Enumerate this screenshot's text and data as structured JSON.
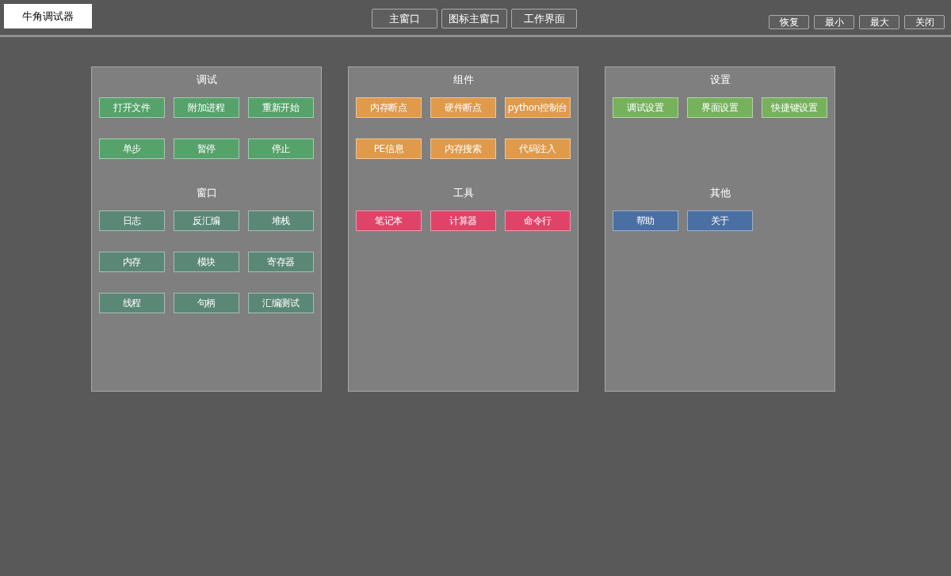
{
  "window": {
    "title": "牛角调试器"
  },
  "nav_buttons": [
    "主窗口",
    "图标主窗口",
    "工作界面"
  ],
  "window_controls": [
    "恢复",
    "最小",
    "最大",
    "关闭"
  ],
  "panels": [
    {
      "sections": [
        {
          "title": "调试",
          "color": "#55a36b",
          "buttons": [
            "打开文件",
            "附加进程",
            "重新开始",
            "单步",
            "暂停",
            "停止"
          ]
        },
        {
          "title": "窗口",
          "color": "#5b8777",
          "buttons": [
            "日志",
            "反汇编",
            "堆栈",
            "内存",
            "模块",
            "寄存器",
            "线程",
            "句柄",
            "汇编测试"
          ]
        }
      ]
    },
    {
      "sections": [
        {
          "title": "组件",
          "color": "#e09a4a",
          "buttons": [
            "内存断点",
            "硬件断点",
            "python控制台",
            "PE信息",
            "内存搜索",
            "代码注入"
          ]
        },
        {
          "title": "工具",
          "color": "#df4468",
          "buttons": [
            "笔记本",
            "计算器",
            "命令行"
          ]
        }
      ]
    },
    {
      "sections": [
        {
          "title": "设置",
          "color": "#76b15c",
          "buttons": [
            "调试设置",
            "界面设置",
            "快捷键设置"
          ]
        },
        {
          "title": "其他",
          "color": "#4a6fa3",
          "buttons": [
            "帮助",
            "关于"
          ]
        }
      ]
    }
  ]
}
